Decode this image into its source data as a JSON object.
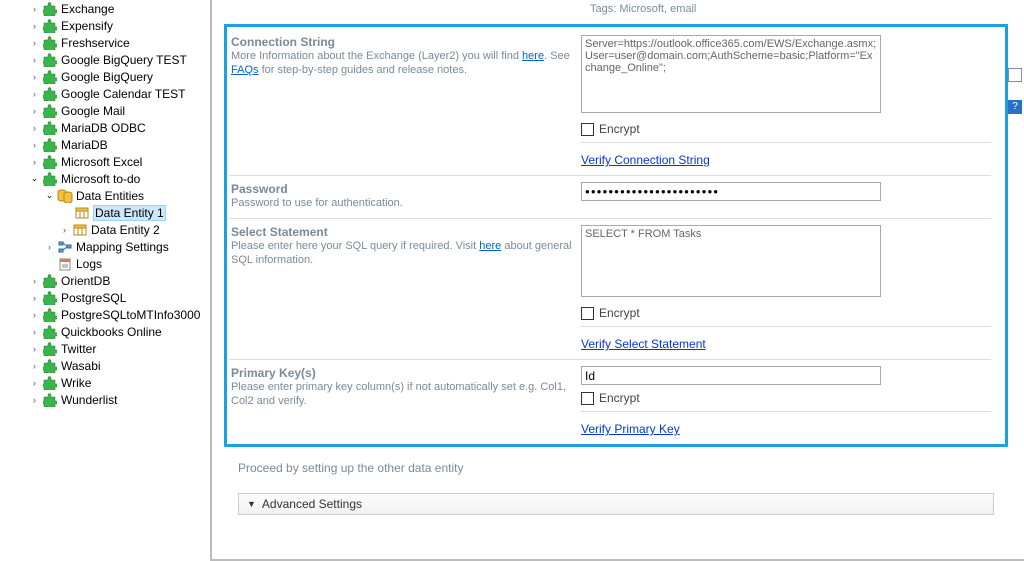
{
  "tags_hint": "Tags: Microsoft, email",
  "tree": {
    "exchange": "Exchange",
    "expensify": "Expensify",
    "freshservice": "Freshservice",
    "bigquerytest": "Google BigQuery TEST",
    "bigquery": "Google BigQuery",
    "gcal": "Google Calendar TEST",
    "gmail": "Google Mail",
    "mariaodbc": "MariaDB ODBC",
    "maria": "MariaDB",
    "excel": "Microsoft Excel",
    "mstodo": "Microsoft to-do",
    "dataentities": "Data Entities",
    "de1": "Data Entity 1",
    "de2": "Data Entity 2",
    "mapping": "Mapping Settings",
    "logs": "Logs",
    "orient": "OrientDB",
    "pg": "PostgreSQL",
    "pgmt": "PostgreSQLtoMTInfo3000",
    "qb": "Quickbooks Online",
    "twitter": "Twitter",
    "wasabi": "Wasabi",
    "wrike": "Wrike",
    "wunderlist": "Wunderlist"
  },
  "conn": {
    "title": "Connection String",
    "desc1": "More Information about the Exchange (Layer2) you will find ",
    "here": "here",
    "desc2": ". See ",
    "faqs": "FAQs",
    "desc3": " for step-by-step guides and release notes.",
    "value": "Server=https://outlook.office365.com/EWS/Exchange.asmx;User=user@domain.com;AuthScheme=basic;Platform=\"Exchange_Online\";",
    "encrypt": "Encrypt",
    "verify": "Verify Connection String"
  },
  "pw": {
    "title": "Password",
    "desc": "Password to use for authentication.",
    "value": "●●●●●●●●●●●●●●●●●●●●●●●"
  },
  "sel": {
    "title": "Select Statement",
    "desc1": "Please enter here your SQL query if required. Visit ",
    "here": "here",
    "desc2": " about general SQL information.",
    "value": "SELECT * FROM Tasks",
    "encrypt": "Encrypt",
    "verify": "Verify Select Statement"
  },
  "pk": {
    "title": "Primary Key(s)",
    "desc": "Please enter primary key column(s) if not automatically set e.g. Col1, Col2 and verify.",
    "value": "Id",
    "encrypt": "Encrypt",
    "verify": "Verify Primary Key"
  },
  "proceed": "Proceed by setting up the other data entity",
  "advanced": "Advanced Settings"
}
